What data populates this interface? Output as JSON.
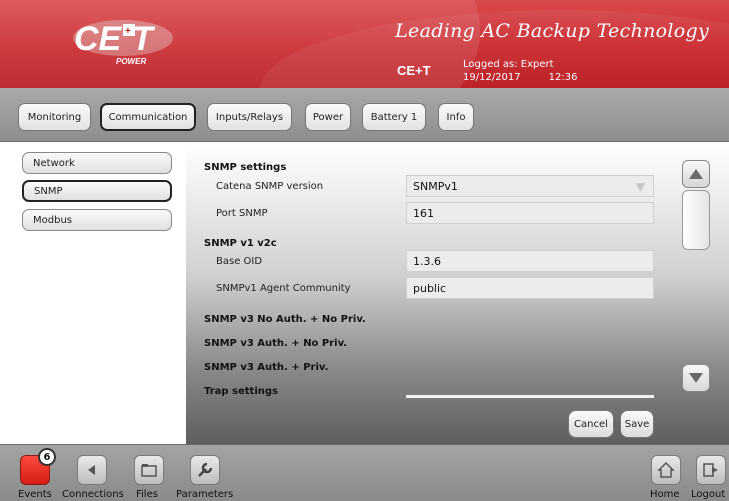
{
  "header": {
    "tagline": "Leading AC Backup Technology",
    "brand": "CE+T",
    "logged_as": "Logged as: Expert",
    "date": "19/12/2017",
    "time": "12:36",
    "logo_text": "CE+T",
    "logo_subtext": "POWER",
    "accent_color": "#c9252a"
  },
  "tabs": [
    {
      "label": "Monitoring",
      "active": false
    },
    {
      "label": "Communication",
      "active": true
    },
    {
      "label": "Inputs/Relays",
      "active": false
    },
    {
      "label": "Power",
      "active": false
    },
    {
      "label": "Battery 1",
      "active": false
    },
    {
      "label": "Info",
      "active": false
    }
  ],
  "sidebar": {
    "items": [
      {
        "label": "Network",
        "active": false
      },
      {
        "label": "SNMP",
        "active": true
      },
      {
        "label": "Modbus",
        "active": false
      }
    ]
  },
  "main": {
    "snmp_settings": "SNMP settings",
    "catena_version_label": "Catena SNMP version",
    "catena_version_value": "SNMPv1",
    "port_label": "Port SNMP",
    "port_value": "161",
    "v1v2c_title": "SNMP v1 v2c",
    "base_oid_label": "Base OID",
    "base_oid_value": "1.3.6",
    "community_label": "SNMPv1 Agent Community",
    "community_value": "public",
    "v3_noauth": "SNMP v3 No Auth. + No Priv.",
    "v3_auth_nopriv": "SNMP v3 Auth. + No Priv.",
    "v3_auth_priv": "SNMP v3 Auth. + Priv.",
    "trap_settings": "Trap settings",
    "cancel_label": "Cancel",
    "save_label": "Save"
  },
  "bottom": {
    "events_label": "Events",
    "events_count": "6",
    "connections_label": "Connections",
    "files_label": "Files",
    "parameters_label": "Parameters",
    "home_label": "Home",
    "logout_label": "Logout"
  }
}
